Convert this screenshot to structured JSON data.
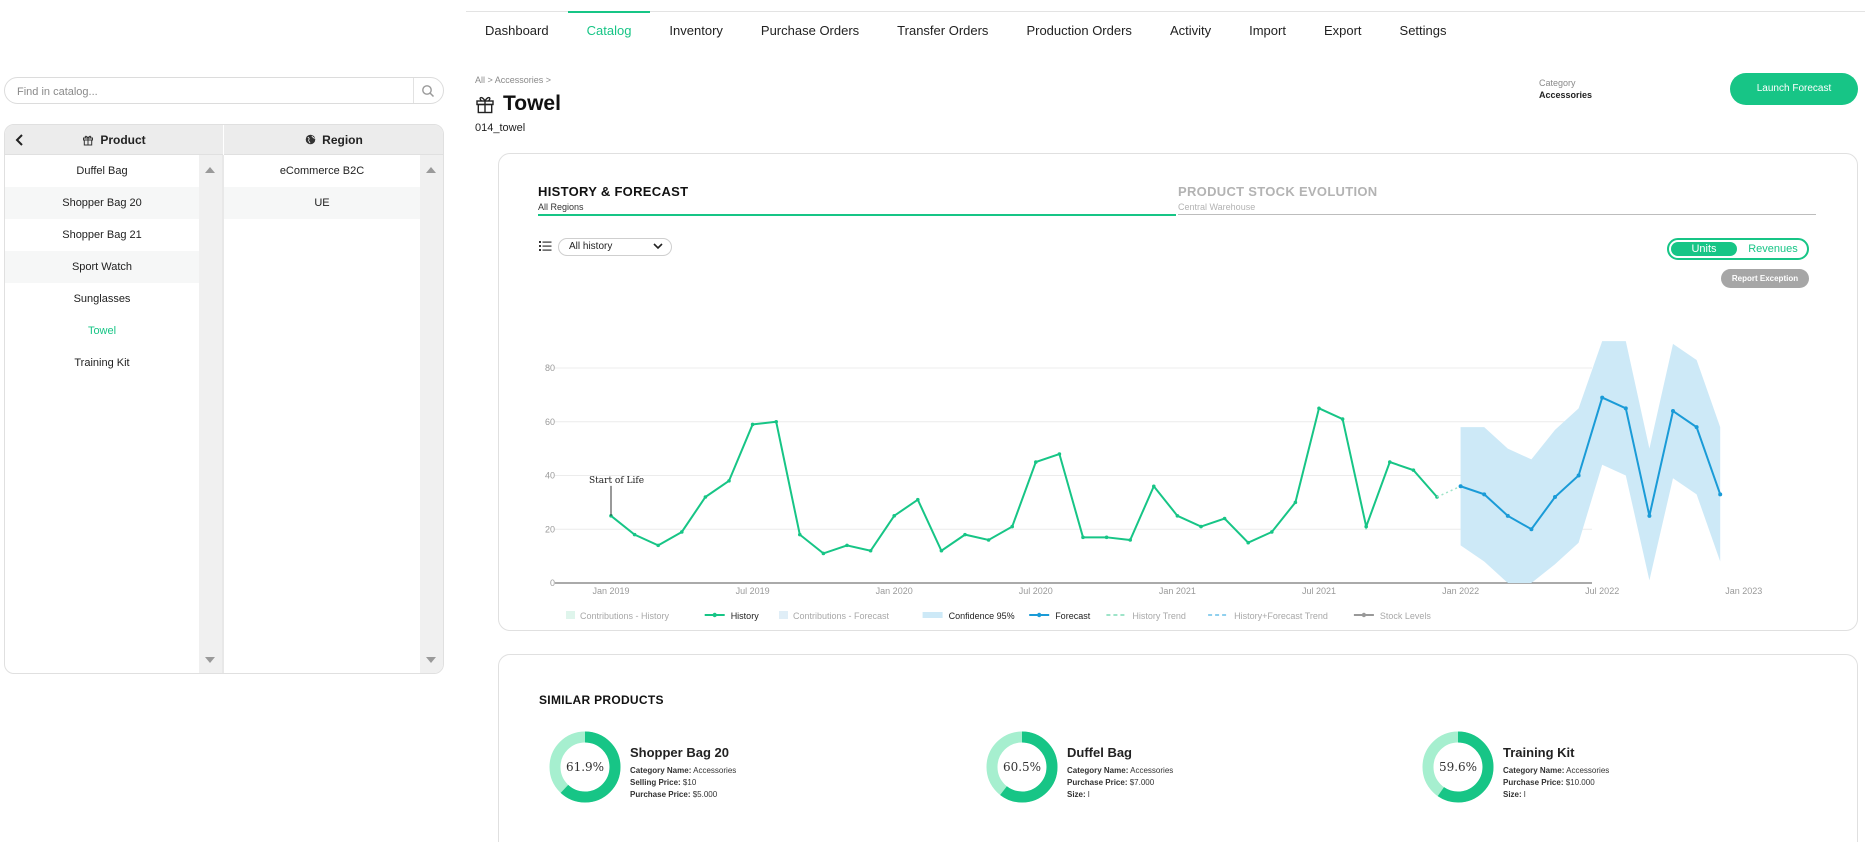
{
  "nav": [
    "Dashboard",
    "Catalog",
    "Inventory",
    "Purchase Orders",
    "Transfer Orders",
    "Production Orders",
    "Activity",
    "Import",
    "Export",
    "Settings"
  ],
  "nav_active": 1,
  "search": {
    "placeholder": "Find in catalog..."
  },
  "columns": {
    "product": "Product",
    "region": "Region"
  },
  "products": [
    "Duffel Bag",
    "Shopper Bag 20",
    "Shopper Bag 21",
    "Sport Watch",
    "Sunglasses",
    "Towel",
    "Training Kit"
  ],
  "selected_product_index": 5,
  "regions": [
    "eCommerce B2C",
    "UE"
  ],
  "breadcrumb": "All > Accessories >",
  "product_title": "Towel",
  "product_code": "014_towel",
  "category": {
    "label": "Category",
    "value": "Accessories"
  },
  "launch_button": "Launch Forecast",
  "tabs": [
    {
      "title": "HISTORY & FORECAST",
      "subtitle": "All Regions"
    },
    {
      "title": "PRODUCT STOCK EVOLUTION",
      "subtitle": "Central Warehouse"
    }
  ],
  "history_select": "All history",
  "toggle": {
    "on": "Units",
    "off": "Revenues"
  },
  "report_button": "Report Exception",
  "chart_data": {
    "type": "line",
    "ylim": [
      0,
      80
    ],
    "yticks": [
      "0",
      "20",
      "40",
      "60",
      "80"
    ],
    "xticks": [
      "Jan 2019",
      "Jul 2019",
      "Jan 2020",
      "Jul 2020",
      "Jan 2021",
      "Jul 2021",
      "Jan 2022",
      "Jul 2022",
      "Jan 2023"
    ],
    "annotation": "Start of Life",
    "grid": true,
    "legend_position": "bottom",
    "legend": [
      "Contributions - History",
      "History",
      "Contributions - Forecast",
      "Confidence 95%",
      "Forecast",
      "History Trend",
      "History+Forecast Trend",
      "Stock Levels"
    ],
    "history": {
      "x": [
        "2019-01",
        "2019-02",
        "2019-03",
        "2019-04",
        "2019-05",
        "2019-06",
        "2019-07",
        "2019-08",
        "2019-09",
        "2019-10",
        "2019-11",
        "2019-12",
        "2020-01",
        "2020-02",
        "2020-03",
        "2020-04",
        "2020-05",
        "2020-06",
        "2020-07",
        "2020-08",
        "2020-09",
        "2020-10",
        "2020-11",
        "2020-12",
        "2021-01",
        "2021-02",
        "2021-03",
        "2021-04",
        "2021-05",
        "2021-06",
        "2021-07",
        "2021-08",
        "2021-09",
        "2021-10",
        "2021-11",
        "2021-12"
      ],
      "values": [
        25,
        18,
        14,
        19,
        32,
        38,
        59,
        60,
        18,
        11,
        14,
        12,
        25,
        31,
        12,
        18,
        16,
        21,
        45,
        48,
        17,
        17,
        16,
        36,
        25,
        21,
        24,
        15,
        19,
        30,
        65,
        61,
        21,
        45,
        42,
        32
      ]
    },
    "forecast": {
      "x": [
        "2022-01",
        "2022-02",
        "2022-03",
        "2022-04",
        "2022-05",
        "2022-06",
        "2022-07",
        "2022-08",
        "2022-09",
        "2022-10",
        "2022-11",
        "2022-12"
      ],
      "values": [
        36,
        33,
        25,
        20,
        32,
        40,
        69,
        65,
        25,
        64,
        58,
        33
      ],
      "upper": [
        58,
        58,
        50,
        46,
        57,
        65,
        94,
        90,
        50,
        89,
        83,
        58
      ],
      "lower": [
        14,
        8,
        0,
        0,
        7,
        15,
        44,
        40,
        1,
        39,
        33,
        8
      ]
    }
  },
  "similar_title": "SIMILAR PRODUCTS",
  "similar_products": [
    {
      "name": "Shopper Bag 20",
      "score": "61.9%",
      "fraction": 0.619,
      "lines": [
        [
          "Category Name:",
          "Accessories"
        ],
        [
          "Selling Price:",
          "$10"
        ],
        [
          "Purchase Price:",
          "$5.000"
        ]
      ]
    },
    {
      "name": "Duffel Bag",
      "score": "60.5%",
      "fraction": 0.605,
      "lines": [
        [
          "Category Name:",
          "Accessories"
        ],
        [
          "Purchase Price:",
          "$7.000"
        ],
        [
          "Size:",
          "l"
        ]
      ]
    },
    {
      "name": "Training Kit",
      "score": "59.6%",
      "fraction": 0.596,
      "lines": [
        [
          "Category Name:",
          "Accessories"
        ],
        [
          "Purchase Price:",
          "$10.000"
        ],
        [
          "Size:",
          "l"
        ]
      ]
    }
  ],
  "colors": {
    "accent": "#17c586",
    "forecast": "#1a9bd7",
    "confidence": "#cde9f7",
    "donut_light": "#a6efcf"
  }
}
